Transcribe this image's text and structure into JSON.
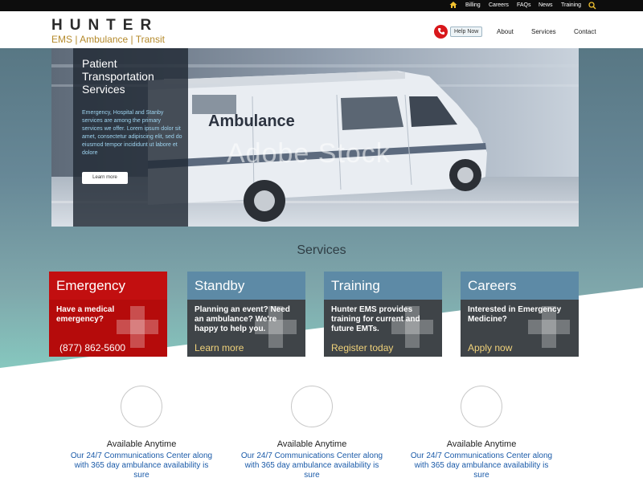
{
  "topbar": {
    "links": [
      {
        "label": "Billing"
      },
      {
        "label": "Careers"
      },
      {
        "label": "FAQs"
      },
      {
        "label": "News"
      },
      {
        "label": "Training"
      }
    ]
  },
  "header": {
    "brand_name": "HUNTER",
    "brand_tagline": "EMS | Ambulance | Transit",
    "help_button": "Help Now",
    "nav": [
      {
        "label": "About"
      },
      {
        "label": "Services"
      },
      {
        "label": "Contact"
      }
    ]
  },
  "hero": {
    "title": "Patient Transportation Services",
    "text": "Emergency, Hospital and Stanby services are among the primary services we offer. Lorem ipsum dolor sit amet, consectetur adipiscing elit, sed do eiusmod tempor incididunt ut labore et dolore",
    "button": "Learn more",
    "vehicle_label": "Ambulance",
    "watermark": "Adobe Stock"
  },
  "services": {
    "title": "Services",
    "cards": [
      {
        "title": "Emergency",
        "text": "Have a medical emergency?",
        "link": "(877) 862-5600"
      },
      {
        "title": "Standby",
        "text": "Planning an event? Need an ambulance? We're happy to help you.",
        "link": "Learn more"
      },
      {
        "title": "Training",
        "text": "Hunter EMS provides training for current and future EMTs.",
        "link": "Register today"
      },
      {
        "title": "Careers",
        "text": "Interested in Emergency Medicine?",
        "link": "Apply now"
      }
    ]
  },
  "features": [
    {
      "title": "Available Anytime",
      "text": "Our 24/7 Communications Center along with 365 day ambulance availability is sure"
    },
    {
      "title": "Available Anytime",
      "text": "Our 24/7 Communications Center along with 365 day ambulance availability is sure"
    },
    {
      "title": "Available Anytime",
      "text": "Our 24/7 Communications Center along with 365 day ambulance availability is sure"
    }
  ],
  "colors": {
    "emergency_red": "#c20f10",
    "card_blue": "#5d8aa6",
    "card_dark": "#3f4448",
    "link_yellow": "#f0d27a",
    "brand_gold": "#b4892a",
    "feature_text_blue": "#1a5aa8"
  },
  "icons": {
    "home": "home-icon",
    "search": "search-icon",
    "phone": "phone-icon",
    "cross": "medical-cross-icon"
  }
}
